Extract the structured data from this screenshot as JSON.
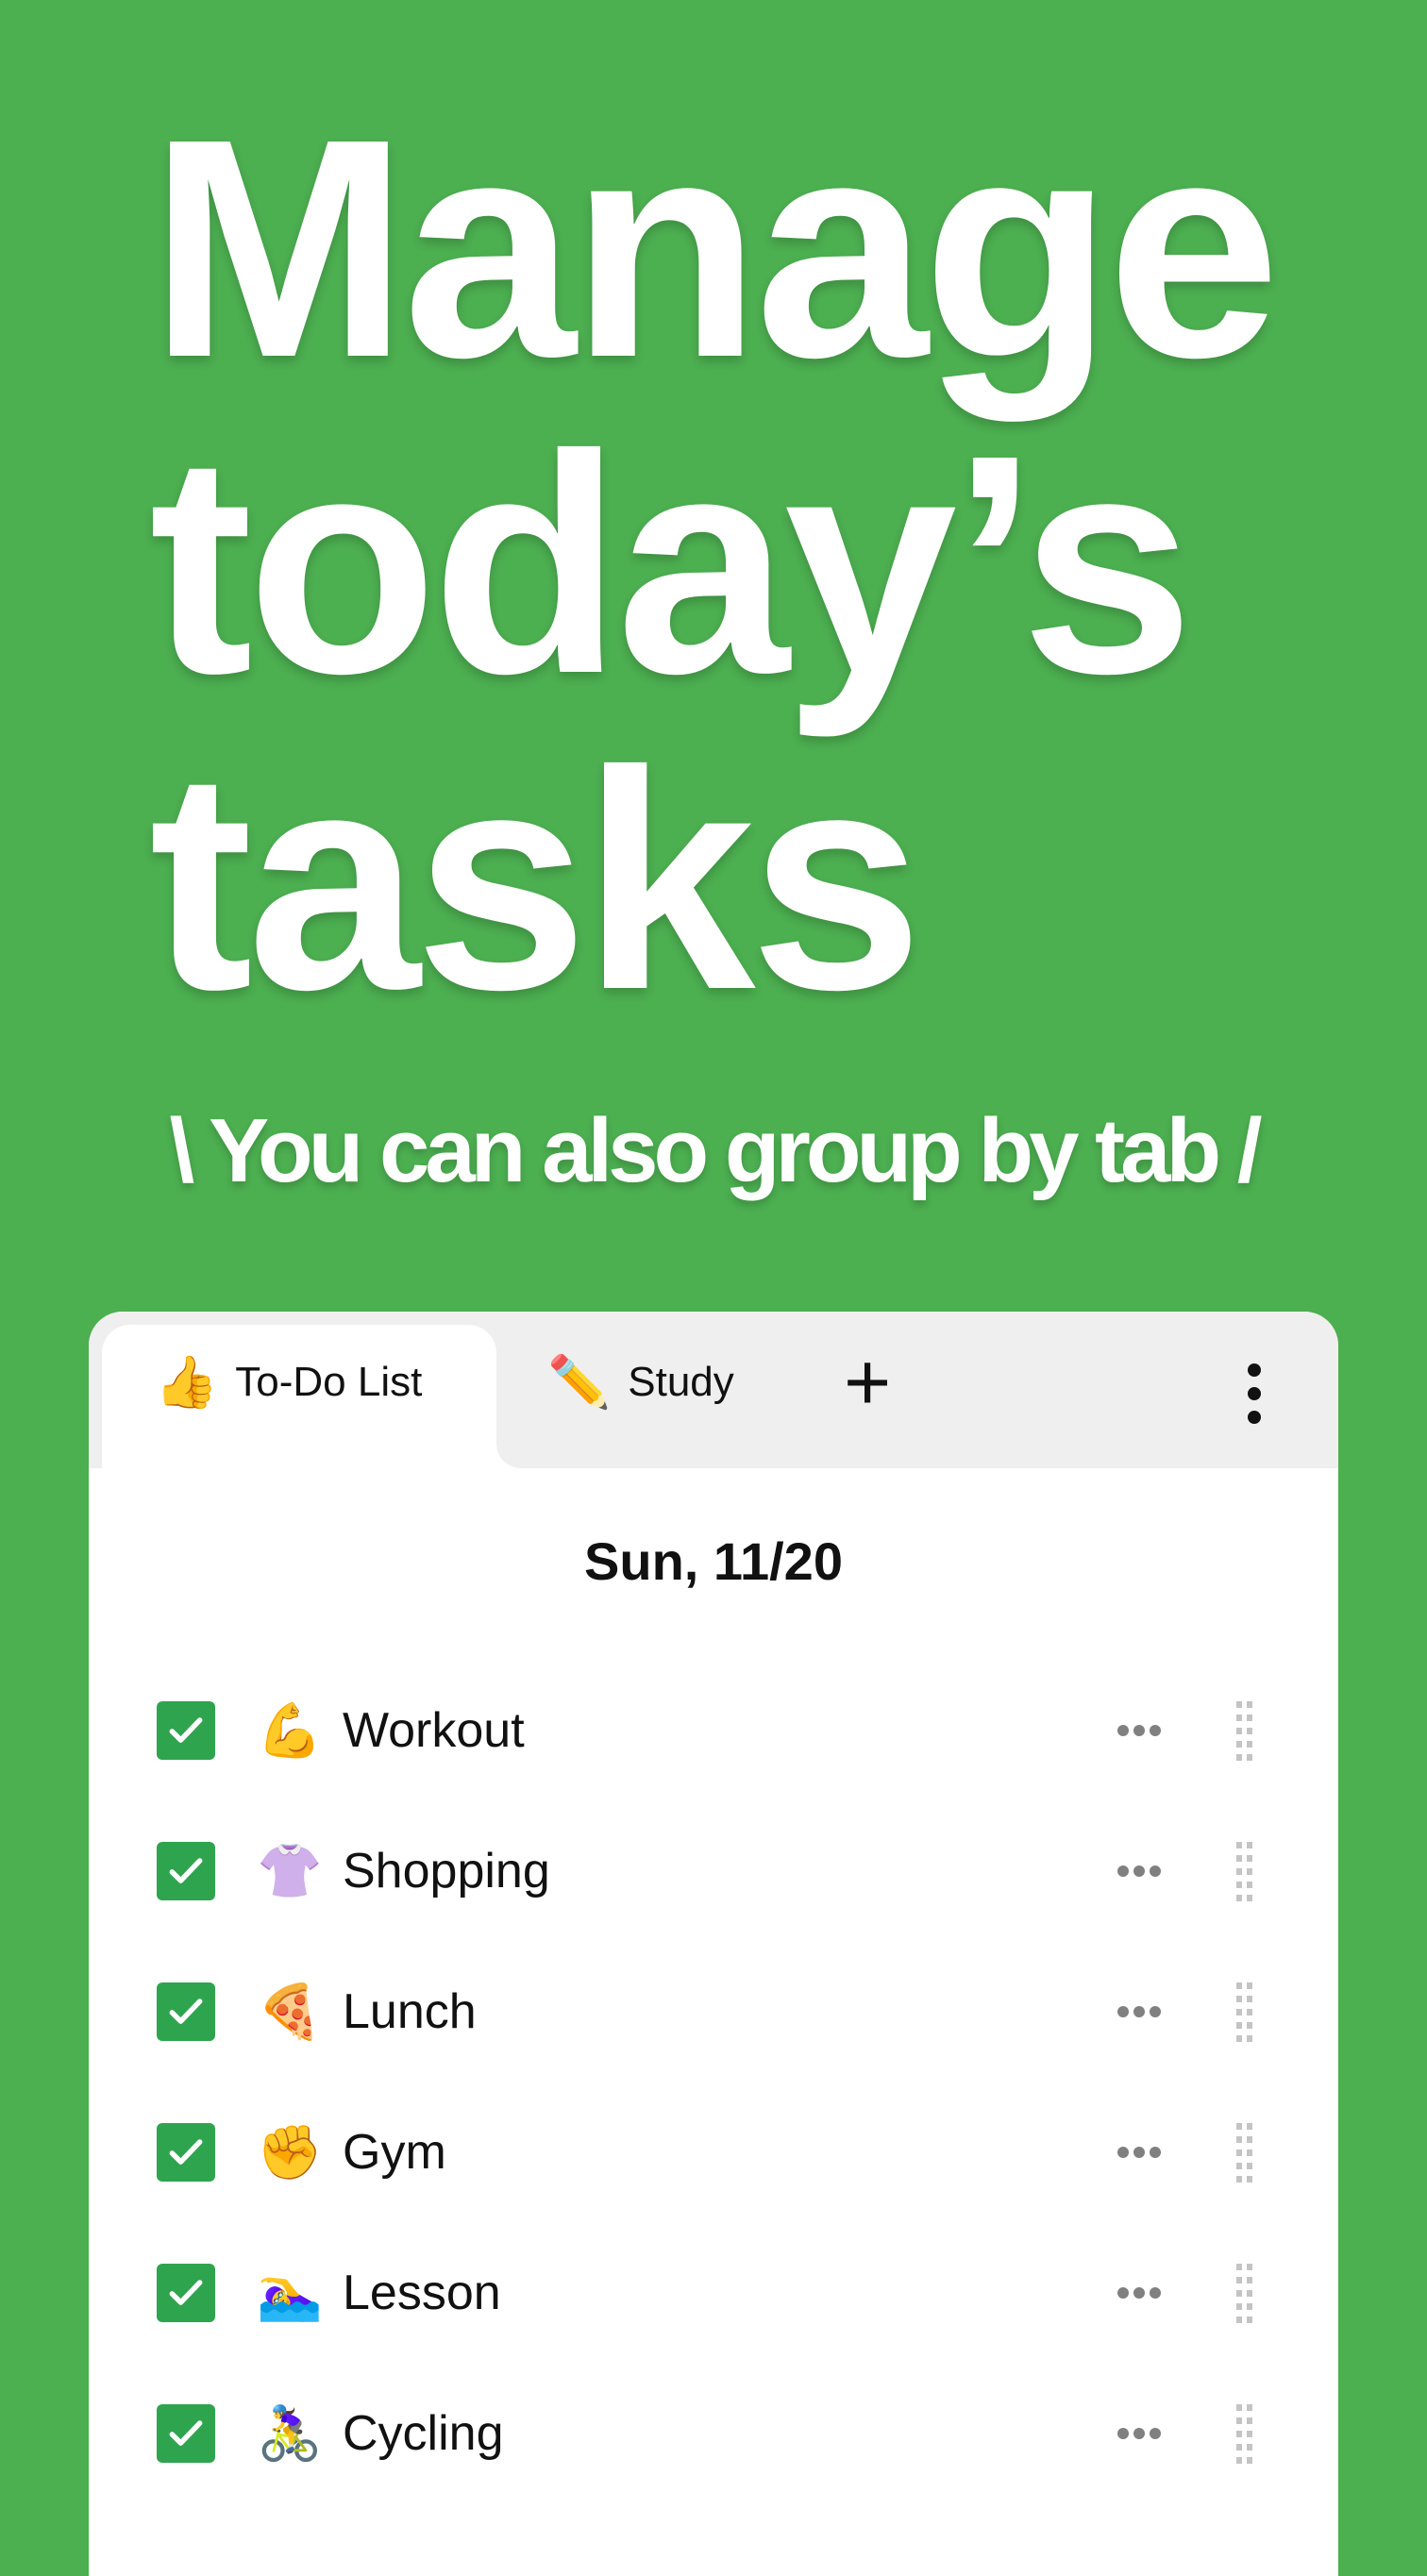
{
  "headline": {
    "lines": [
      "Manage",
      "today’s",
      "tasks"
    ]
  },
  "subtitle": "\\ You can also group by tab /",
  "tabs": [
    {
      "emoji": "👍",
      "label": "To-Do List",
      "active": true
    },
    {
      "emoji": "✏️",
      "label": "Study",
      "active": false
    }
  ],
  "add_tab_label": "+",
  "date": "Sun, 11/20",
  "tasks": [
    {
      "emoji": "💪",
      "label": "Workout",
      "checked": true
    },
    {
      "emoji": "👚",
      "label": "Shopping",
      "checked": true
    },
    {
      "emoji": "🍕",
      "label": "Lunch",
      "checked": true
    },
    {
      "emoji": "✊",
      "label": "Gym",
      "checked": true
    },
    {
      "emoji": "🏊‍♀️",
      "label": "Lesson",
      "checked": true
    },
    {
      "emoji": "🚴‍♀️",
      "label": "Cycling",
      "checked": true
    }
  ],
  "colors": {
    "background": "#4caf50",
    "checkbox": "#2ea44f",
    "tabbar": "#efefef"
  },
  "icons": {
    "checkbox": "checkmark-icon",
    "more": "ellipsis-icon",
    "drag": "drag-handle-icon",
    "menu": "kebab-menu-icon",
    "add": "plus-icon"
  }
}
